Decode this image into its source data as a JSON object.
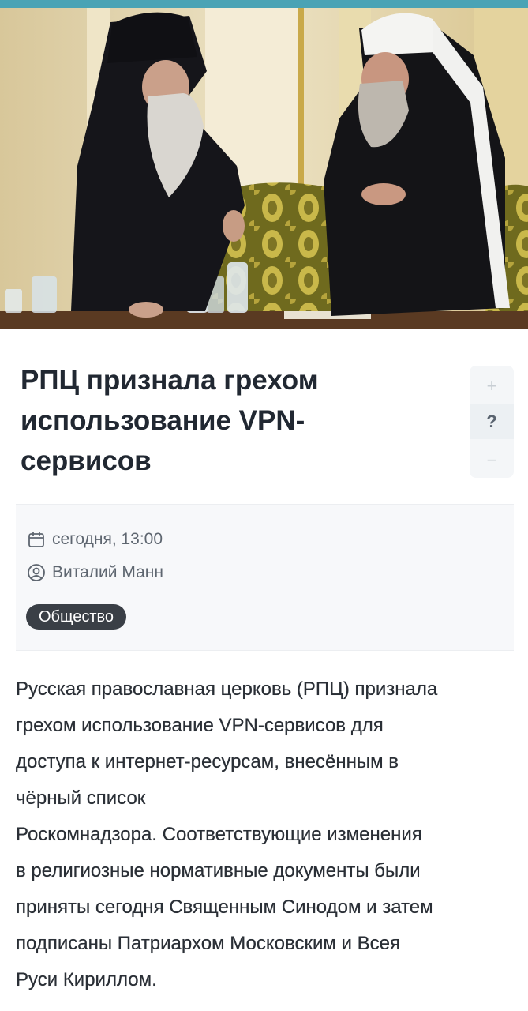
{
  "article": {
    "title": "РПЦ признала грехом использование VPN-сервисов",
    "title_lines": [
      "РПЦ признала грехом",
      "использование VPN-",
      "сервисов"
    ],
    "date": "сегодня, 13:00",
    "author": "Виталий Манн",
    "category": "Общество",
    "body_lines": [
      "Русская православная церковь (РПЦ) признала",
      "грехом использование VPN-сервисов для",
      "доступа к интернет-ресурсам, внесённым в",
      "чёрный список",
      "Роскомнадзора. Соответствующие изменения",
      "в религиозные нормативные документы были",
      "приняты сегодня Священным Синодом и затем",
      "подписаны Патриархом Московским и Всея",
      "Руси Кириллом."
    ]
  },
  "zoom_controls": {
    "plus": "+",
    "help": "?",
    "minus": "−"
  },
  "icons": {
    "date": "calendar-icon",
    "author": "user-circle-icon"
  },
  "colors": {
    "accent_bar": "#4aa3b5",
    "tag_bg": "#3a3f46",
    "meta_bg": "#f7f8fa"
  }
}
